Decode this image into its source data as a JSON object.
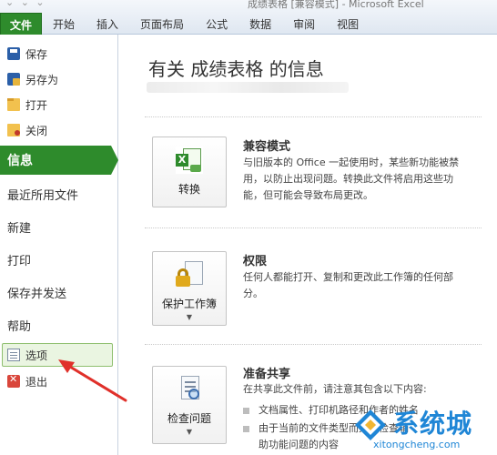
{
  "window": {
    "title": "成绩表格 [兼容模式] - Microsoft Excel",
    "qat": "⌄ ⌄ ⌄"
  },
  "ribbon": {
    "tabs": [
      "文件",
      "开始",
      "插入",
      "页面布局",
      "公式",
      "数据",
      "审阅",
      "视图"
    ]
  },
  "leftnav": {
    "small_items": [
      {
        "label": "保存",
        "icon": "save-icon"
      },
      {
        "label": "另存为",
        "icon": "save-as-icon"
      },
      {
        "label": "打开",
        "icon": "open-folder-icon"
      },
      {
        "label": "关闭",
        "icon": "close-folder-icon"
      }
    ],
    "active_item": "信息",
    "big_items": [
      "最近所用文件",
      "新建",
      "打印",
      "保存并发送",
      "帮助"
    ],
    "bottom_items": [
      {
        "label": "选项",
        "icon": "options-icon"
      },
      {
        "label": "退出",
        "icon": "exit-icon"
      }
    ]
  },
  "main": {
    "title": "有关 成绩表格 的信息",
    "sections": [
      {
        "button_label": "转换",
        "icon": "excel-convert-icon",
        "title": "兼容模式",
        "description": "与旧版本的 Office 一起使用时，某些新功能被禁用，以防止出现问题。转换此文件将启用这些功能，但可能会导致布局更改。"
      },
      {
        "button_label": "保护工作簿",
        "icon": "lock-icon",
        "has_dropdown": true,
        "title": "权限",
        "description": "任何人都能打开、复制和更改此工作簿的任何部分。"
      },
      {
        "button_label": "检查问题",
        "icon": "inspect-document-icon",
        "has_dropdown": true,
        "title": "准备共享",
        "description": "在共享此文件前，请注意其包含以下内容:",
        "bullets": [
          "文档属性、打印机路径和作者的姓名",
          "由于当前的文件类型而无法检查辅",
          "助功能问题的内容"
        ]
      }
    ]
  },
  "watermark": {
    "text": "系统城",
    "url": "xitongcheng.com"
  },
  "colors": {
    "file_green": "#2e8b2c",
    "annotation_red": "#e0302a",
    "watermark_blue": "#1f86d6"
  }
}
